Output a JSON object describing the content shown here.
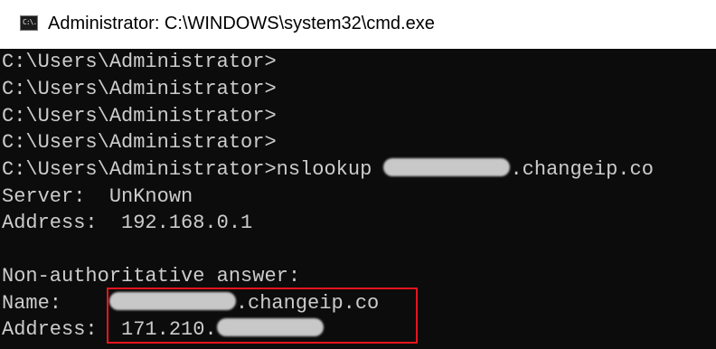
{
  "window": {
    "title": "Administrator: C:\\WINDOWS\\system32\\cmd.exe",
    "icon_glyph": "C:\\."
  },
  "console": {
    "lines": [
      "C:\\Users\\Administrator>",
      "C:\\Users\\Administrator>",
      "C:\\Users\\Administrator>",
      "C:\\Users\\Administrator>",
      "C:\\Users\\Administrator>",
      "Server:  UnKnown",
      "Address:  192.168.0.1",
      "",
      "Non-authoritative answer:"
    ],
    "cmd_prompt": "C:\\Users\\Administrator>",
    "cmd_text": "nslookup ",
    "cmd_suffix": ".changeip.co",
    "name_label": "Name:    ",
    "name_suffix": ".changeip.co",
    "address_label": "Address:  ",
    "address_prefix": "171.210."
  },
  "colors": {
    "console_bg": "#0c0c0c",
    "console_text": "#cccccc",
    "highlight_border": "#e8141e"
  }
}
